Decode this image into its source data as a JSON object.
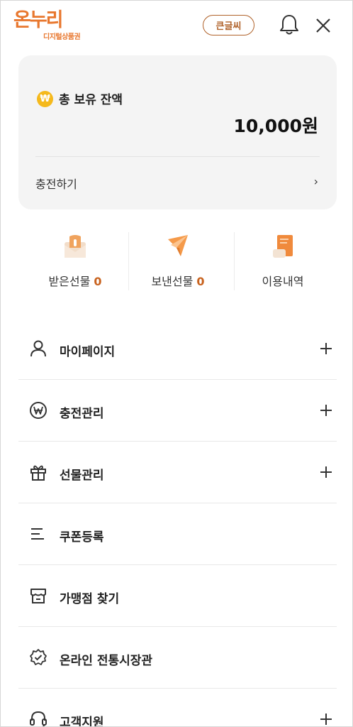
{
  "header": {
    "logo_main": "온누리",
    "logo_sub": "디지털상품권",
    "bigtext_label": "큰글씨"
  },
  "balance_card": {
    "currency_symbol": "₩",
    "title": "총 보유 잔액",
    "amount": "10,000원",
    "charge_label": "충전하기",
    "charge_arrow": "›"
  },
  "stats": [
    {
      "label": "받은선물",
      "count": "0",
      "icon": "received-gift-icon"
    },
    {
      "label": "보낸선물",
      "count": "0",
      "icon": "sent-gift-icon"
    },
    {
      "label": "이용내역",
      "count": "",
      "icon": "history-icon"
    }
  ],
  "menu": [
    {
      "label": "마이페이지",
      "icon": "person-icon",
      "expandable": true
    },
    {
      "label": "충전관리",
      "icon": "won-circle-icon",
      "expandable": true
    },
    {
      "label": "선물관리",
      "icon": "gift-icon",
      "expandable": true
    },
    {
      "label": "쿠폰등록",
      "icon": "list-icon",
      "expandable": false
    },
    {
      "label": "가맹점 찾기",
      "icon": "store-icon",
      "expandable": false
    },
    {
      "label": "온라인 전통시장관",
      "icon": "badge-check-icon",
      "expandable": false
    },
    {
      "label": "고객지원",
      "icon": "headset-icon",
      "expandable": true
    }
  ],
  "colors": {
    "brand": "#e8772e",
    "accent_number": "#c8621e",
    "card_bg": "#f4f4f4",
    "coin": "#f5b91c"
  }
}
